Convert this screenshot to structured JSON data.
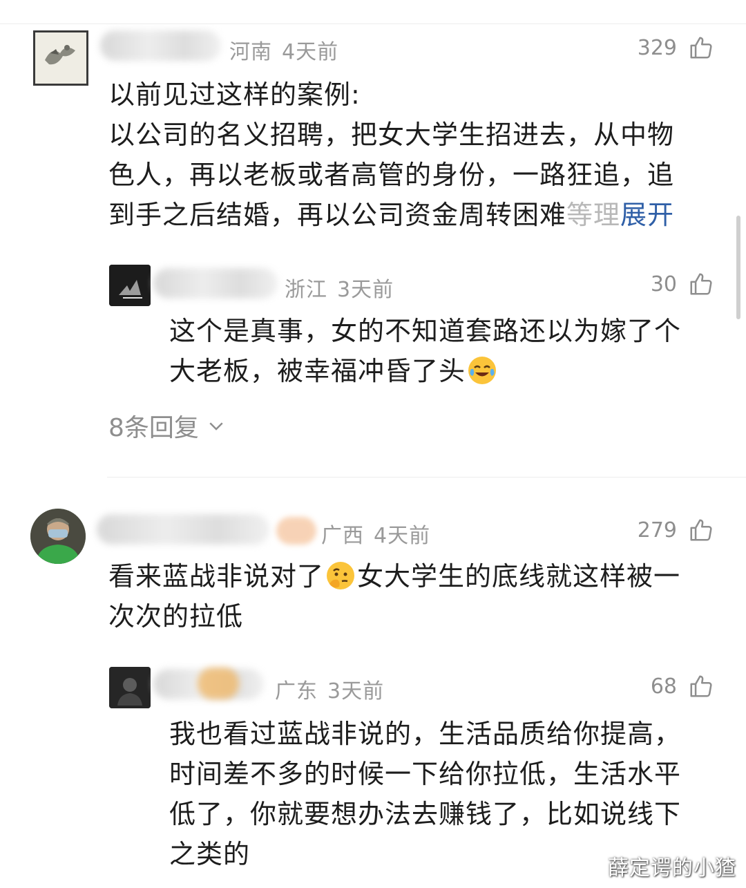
{
  "comments": [
    {
      "location": "河南",
      "time": "4天前",
      "likes": "329",
      "lines": [
        "以前见过这样的案例:",
        "以公司的名义招聘，把女大学生招进去，从中物",
        "色人，再以老板或者高管的身份，一路狂追，追"
      ],
      "last_line": "到手之后结婚，再以公司资金周转困难",
      "last_line_faded": "等理",
      "expand_label": "展开",
      "reply": {
        "location": "浙江",
        "time": "3天前",
        "likes": "30",
        "line1": "这个是真事，女的不知道套路还以为嫁了个",
        "line2": "大老板，被幸福冲昏了头",
        "emoji": "crying-laughing-emoji"
      },
      "replies_label": "8条回复"
    },
    {
      "location": "广西",
      "time": "4天前",
      "likes": "279",
      "line1_a": "看来蓝战非说对了",
      "line1_b": "女大学生的底线就这样被一",
      "line2": "次次的拉低",
      "emoji": "thinking-face-emoji",
      "reply": {
        "location": "广东",
        "time": "3天前",
        "likes": "68",
        "lines": [
          "我也看过蓝战非说的，生活品质给你提高，",
          "时间差不多的时候一下给你拉低，生活水平",
          "低了，你就要想办法去赚钱了，比如说线下",
          "之类的"
        ]
      }
    }
  ],
  "icons": {
    "like": "thumbs-up-icon",
    "chevron": "chevron-down-icon"
  },
  "colors": {
    "link": "#2f5fa7",
    "meta": "#9a9a9a",
    "text": "#1d1d1d"
  },
  "watermark": "薛定谔的小猹"
}
